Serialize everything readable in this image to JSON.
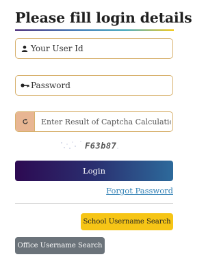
{
  "form": {
    "title": "Please fill login details",
    "user_id": {
      "placeholder": "Your User Id",
      "icon": "user-icon"
    },
    "password": {
      "placeholder": "Password",
      "icon": "key-icon"
    },
    "captcha": {
      "placeholder": "Enter Result of Captcha Calculation",
      "refresh_icon": "refresh-icon",
      "image_text": "F63b87"
    },
    "login_label": "Login",
    "forgot_password_label": "Forgot Password",
    "school_username_label": "School Username Search",
    "office_username_label": "Office Username Search"
  },
  "colors": {
    "field_border": "#d7b06c",
    "refresh_bg": "#e8b693",
    "login_gradient_start": "#2d0a52",
    "login_gradient_end": "#2d6a9b",
    "link": "#2f7fb4",
    "school_button": "#f6c516",
    "office_button": "#6b737a"
  }
}
